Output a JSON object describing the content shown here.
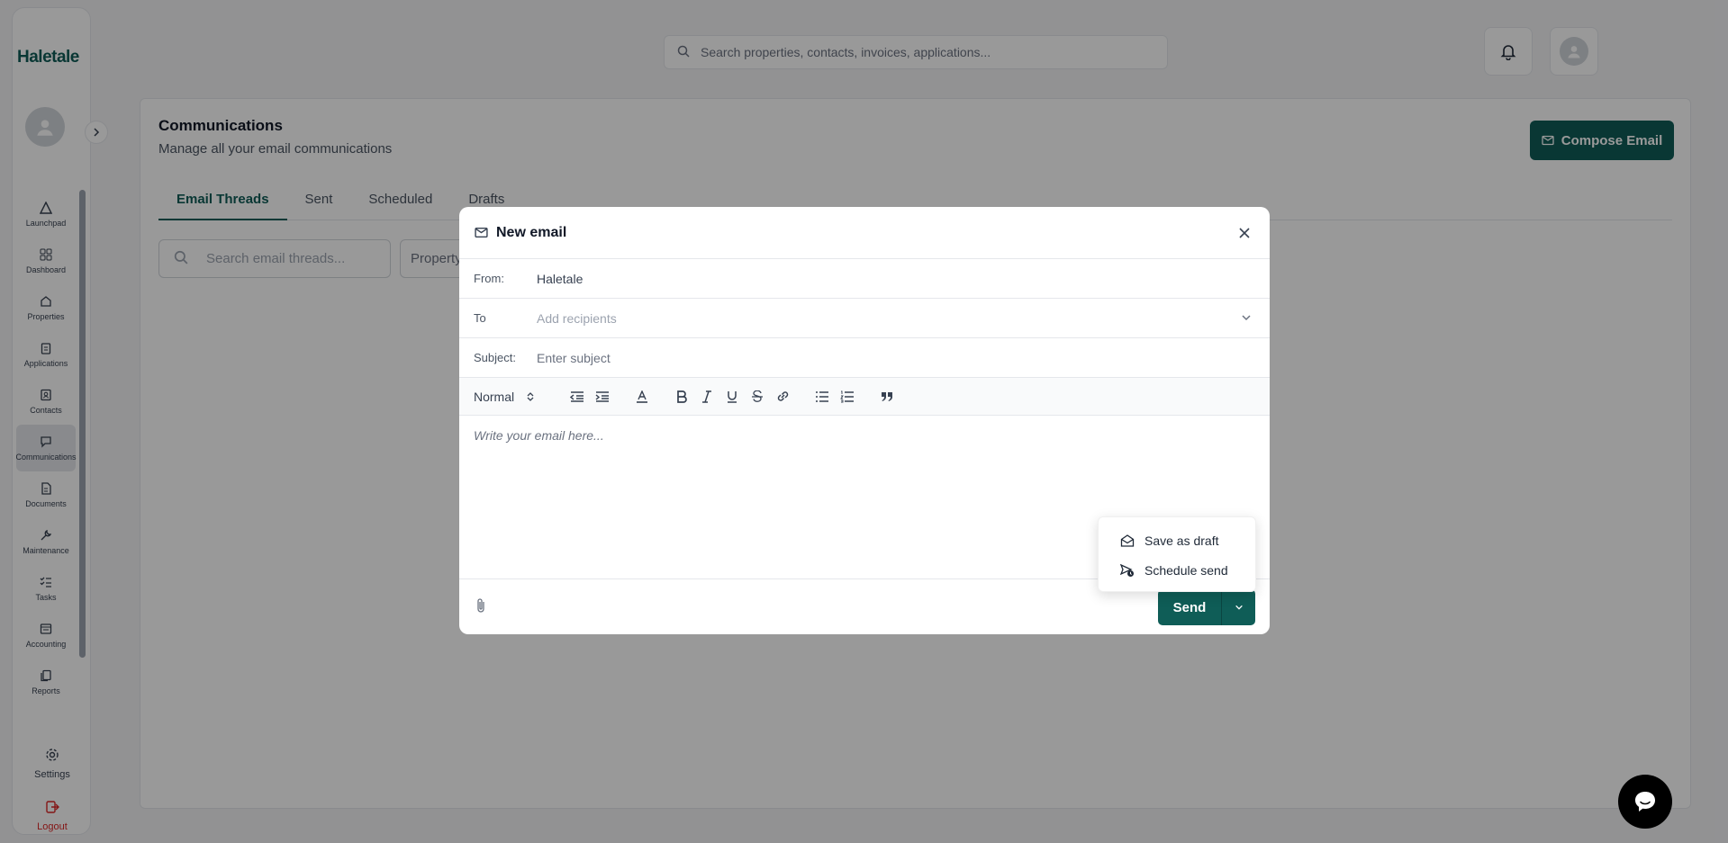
{
  "app": {
    "logo": "Haletale"
  },
  "sidebar": {
    "items": [
      {
        "label": "Launchpad",
        "icon": "launchpad-icon"
      },
      {
        "label": "Dashboard",
        "icon": "grid-icon"
      },
      {
        "label": "Properties",
        "icon": "home-icon"
      },
      {
        "label": "Applications",
        "icon": "clipboard-icon"
      },
      {
        "label": "Contacts",
        "icon": "contact-icon"
      },
      {
        "label": "Communications",
        "icon": "chat-icon",
        "active": true
      },
      {
        "label": "Documents",
        "icon": "document-icon"
      },
      {
        "label": "Maintenance",
        "icon": "wrench-icon"
      },
      {
        "label": "Tasks",
        "icon": "list-check-icon"
      },
      {
        "label": "Accounting",
        "icon": "receipt-icon"
      },
      {
        "label": "Reports",
        "icon": "reports-icon"
      }
    ],
    "settings_label": "Settings",
    "logout_label": "Logout"
  },
  "topbar": {
    "search_placeholder": "Search properties, contacts, invoices, applications..."
  },
  "page": {
    "title": "Communications",
    "subtitle": "Manage all your email communications",
    "compose_label": "Compose Email",
    "tabs": [
      {
        "label": "Email Threads",
        "active": true
      },
      {
        "label": "Sent"
      },
      {
        "label": "Scheduled"
      },
      {
        "label": "Drafts"
      }
    ],
    "thread_search_placeholder": "Search email threads...",
    "property_filter": "Property"
  },
  "modal": {
    "title": "New email",
    "from_label": "From:",
    "from_value": "Haletale",
    "to_label": "To",
    "to_placeholder": "Add recipients",
    "subject_label": "Subject:",
    "subject_placeholder": "Enter subject",
    "format_select": "Normal",
    "body_placeholder": "Write your email here...",
    "send_label": "Send",
    "menu": [
      {
        "label": "Save as draft",
        "icon": "mail-open-icon"
      },
      {
        "label": "Schedule send",
        "icon": "schedule-send-icon"
      }
    ]
  },
  "colors": {
    "brand": "#0f5d57",
    "danger": "#dc2626"
  }
}
